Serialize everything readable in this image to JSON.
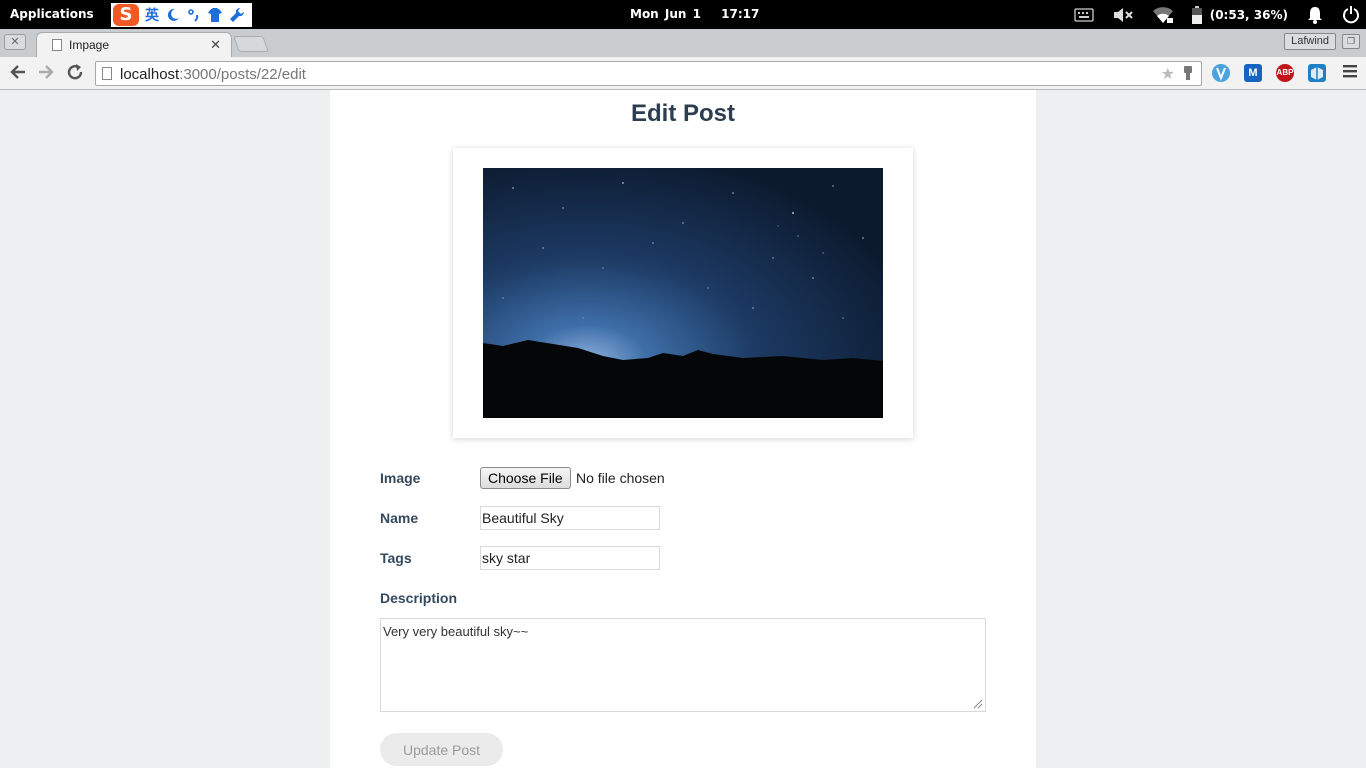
{
  "topbar": {
    "applications": "Applications",
    "clock_day": "Mon Jun  1",
    "clock_time": "17:17",
    "battery": "(0:53, 36%)"
  },
  "ime": {
    "logo": "S",
    "mode": "英",
    "icons": [
      "moon-icon",
      "punctuation-icon",
      "skin-shirt-icon",
      "wrench-icon"
    ]
  },
  "browser": {
    "tab_title": "Impage",
    "profile_name": "Lafwind",
    "url_host": "localhost",
    "url_rest": ":3000/posts/22/edit",
    "extensions": [
      {
        "name": "vimium-extension-icon",
        "label": "V",
        "color": "#4aa3df"
      },
      {
        "name": "m-extension-icon",
        "label": "M",
        "color": "#1565c0"
      },
      {
        "name": "adblock-plus-icon",
        "label": "ABP",
        "color": "#c0161b"
      },
      {
        "name": "cube-extension-icon",
        "label": "",
        "color": "#1e7fc4"
      }
    ]
  },
  "page": {
    "title": "Edit Post",
    "image_label": "Image",
    "file_button": "Choose File",
    "file_status": "No file chosen",
    "name_label": "Name",
    "name_value": "Beautiful Sky",
    "tags_label": "Tags",
    "tags_value": "sky star",
    "description_label": "Description",
    "description_value": "Very very beautiful sky~~",
    "submit_label": "Update Post"
  }
}
